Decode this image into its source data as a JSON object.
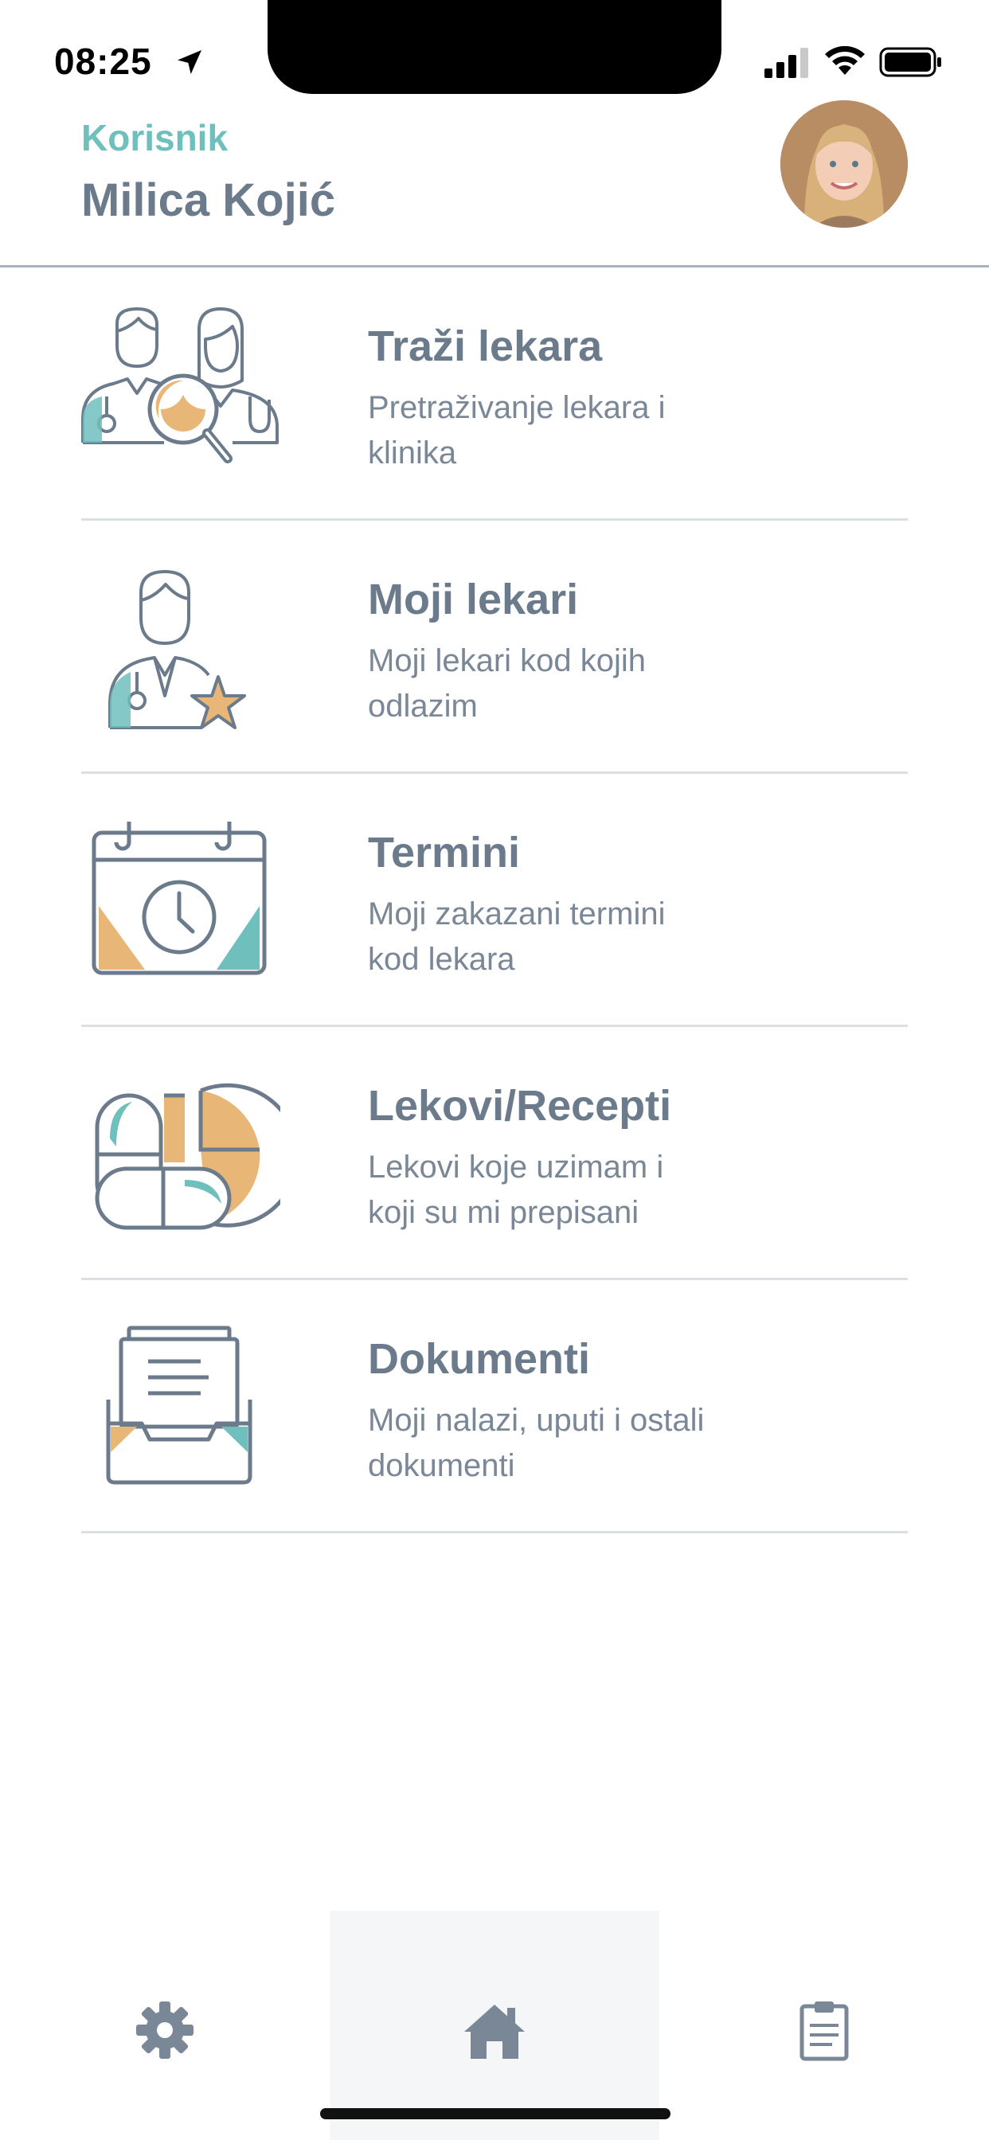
{
  "status_bar": {
    "time": "08:25"
  },
  "header": {
    "role_label": "Korisnik",
    "user_name": "Milica Kojić"
  },
  "menu": {
    "items": [
      {
        "title": "Traži lekara",
        "desc": "Pretraživanje lekara i klinika",
        "icon": "doctor-search-icon"
      },
      {
        "title": "Moji lekari",
        "desc": "Moji lekari kod kojih odlazim",
        "icon": "doctor-star-icon"
      },
      {
        "title": "Termini",
        "desc": "Moji zakazani termini kod lekara",
        "icon": "calendar-clock-icon"
      },
      {
        "title": "Lekovi/Recepti",
        "desc": "Lekovi koje uzimam i koji su mi prepisani",
        "icon": "pills-icon"
      },
      {
        "title": "Dokumenti",
        "desc": "Moji nalazi, uputi i ostali dokumenti",
        "icon": "document-tray-icon"
      }
    ]
  },
  "tab_bar": {
    "tabs": [
      {
        "icon": "gear-icon"
      },
      {
        "icon": "home-icon",
        "selected": true
      },
      {
        "icon": "clipboard-icon"
      }
    ]
  },
  "colors": {
    "accent_teal": "#6fc0bd",
    "accent_orange": "#e8b676",
    "text_slate": "#6b7b8c",
    "divider": "#dcdfe2"
  }
}
